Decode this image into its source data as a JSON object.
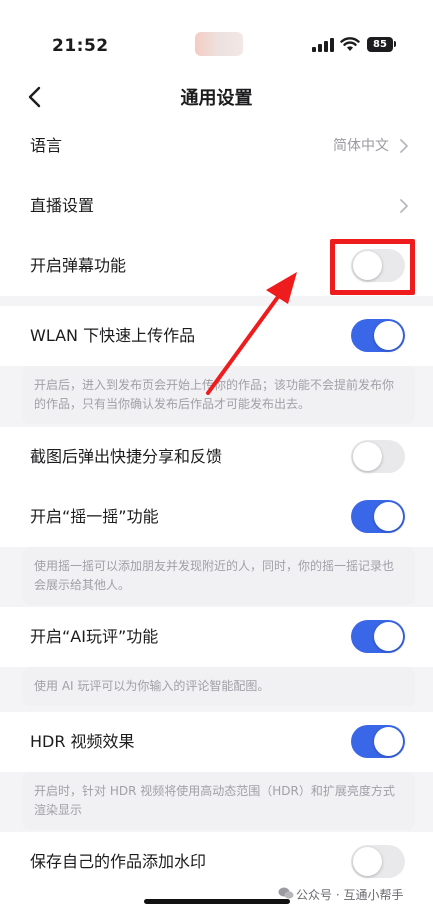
{
  "status_bar": {
    "time": "21:52",
    "battery": "85"
  },
  "nav": {
    "title": "通用设置"
  },
  "rows": {
    "language": {
      "label": "语言",
      "value": "简体中文"
    },
    "live": {
      "label": "直播设置"
    },
    "danmaku": {
      "label": "开启弹幕功能",
      "enabled": false
    },
    "wlan": {
      "label": "WLAN 下快速上传作品",
      "enabled": true,
      "desc": "开启后，进入到发布页会开始上传你的作品；该功能不会提前发布你的作品，只有当你确认发布后作品才可能发布出去。"
    },
    "screenshot": {
      "label": "截图后弹出快捷分享和反馈",
      "enabled": false
    },
    "shake": {
      "label": "开启“摇一摇”功能",
      "enabled": true,
      "desc": "使用摇一摇可以添加朋友并发现附近的人，同时，你的摇一摇记录也会展示给其他人。"
    },
    "ai_comment": {
      "label": "开启“AI玩评”功能",
      "enabled": true,
      "desc": "使用 AI 玩评可以为你输入的评论智能配图。"
    },
    "hdr": {
      "label": "HDR 视频效果",
      "enabled": true,
      "desc": "开启时，针对 HDR 视频将使用高动态范围（HDR）和扩展亮度方式渲染显示"
    },
    "watermark_row": {
      "label": "保存自己的作品添加水印",
      "enabled": false
    }
  },
  "watermark": {
    "text": "公众号 · 互通小帮手"
  },
  "colors": {
    "accent": "#3a67e8",
    "highlight": "#ee1c1c",
    "toggle_off": "#e9e9ec"
  }
}
